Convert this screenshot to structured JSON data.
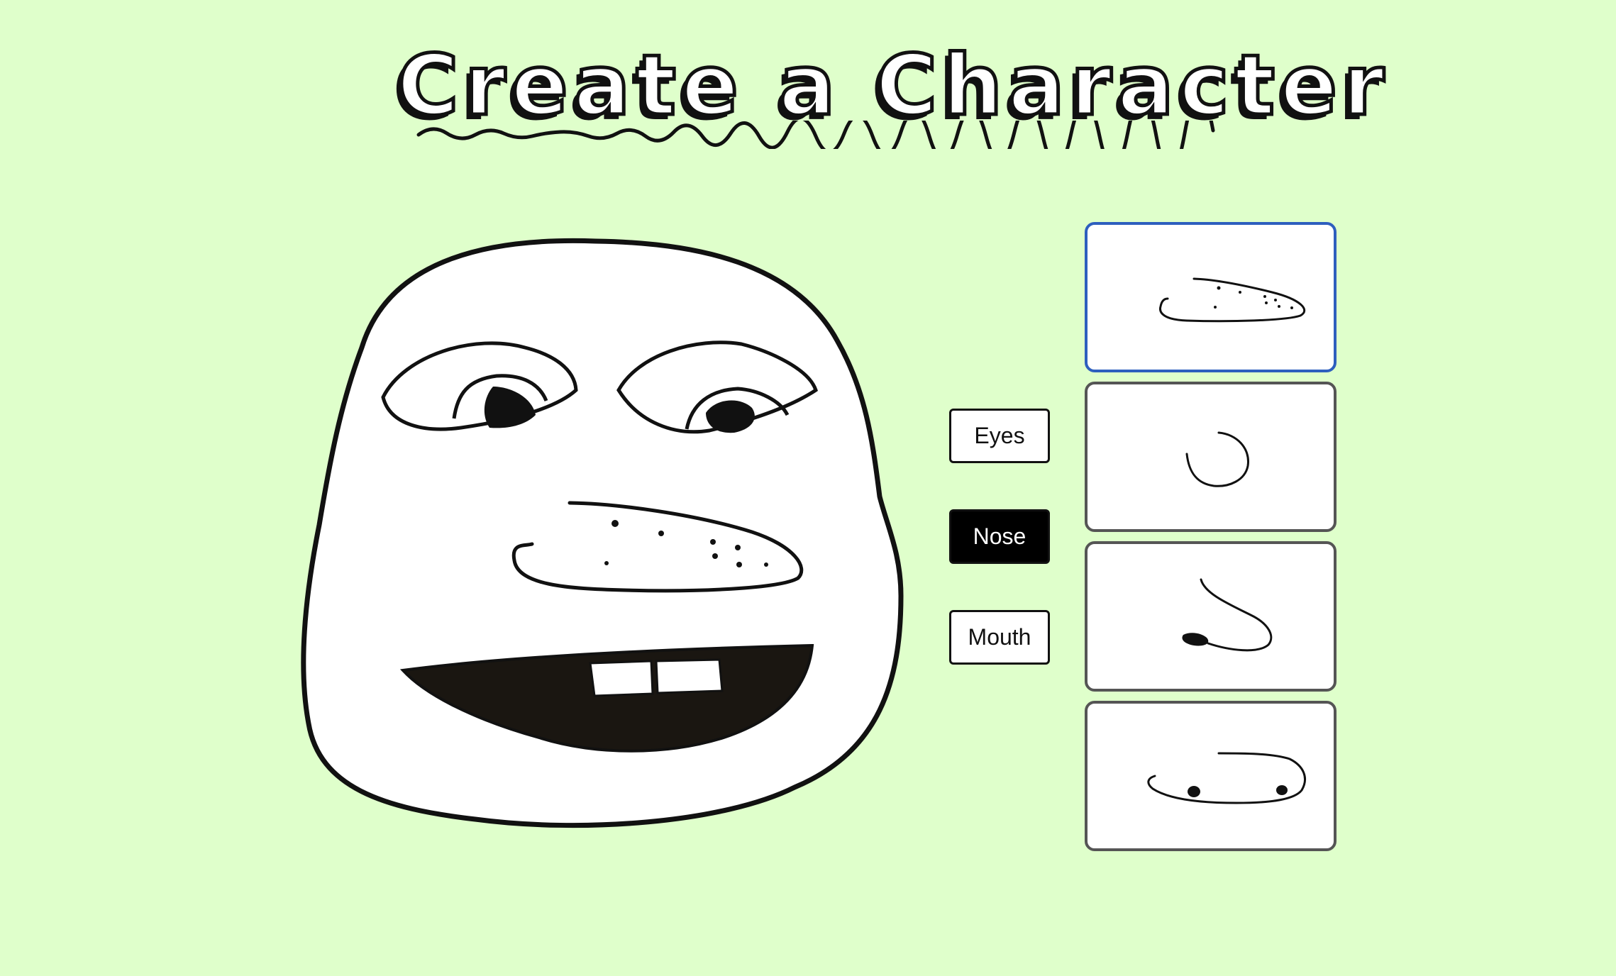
{
  "title": "Create a Character",
  "parts": [
    {
      "label": "Eyes",
      "active": false
    },
    {
      "label": "Nose",
      "active": true
    },
    {
      "label": "Mouth",
      "active": false
    }
  ],
  "options": [
    {
      "icon": "long-freckled-nose-icon",
      "selected": true
    },
    {
      "icon": "round-nose-icon",
      "selected": false
    },
    {
      "icon": "hooked-nose-icon",
      "selected": false
    },
    {
      "icon": "flat-nostril-nose-icon",
      "selected": false
    }
  ],
  "colors": {
    "background": "#dfffcb",
    "selected_border": "#2e5fbe",
    "card_border": "#555555",
    "active_button": "#000000"
  }
}
